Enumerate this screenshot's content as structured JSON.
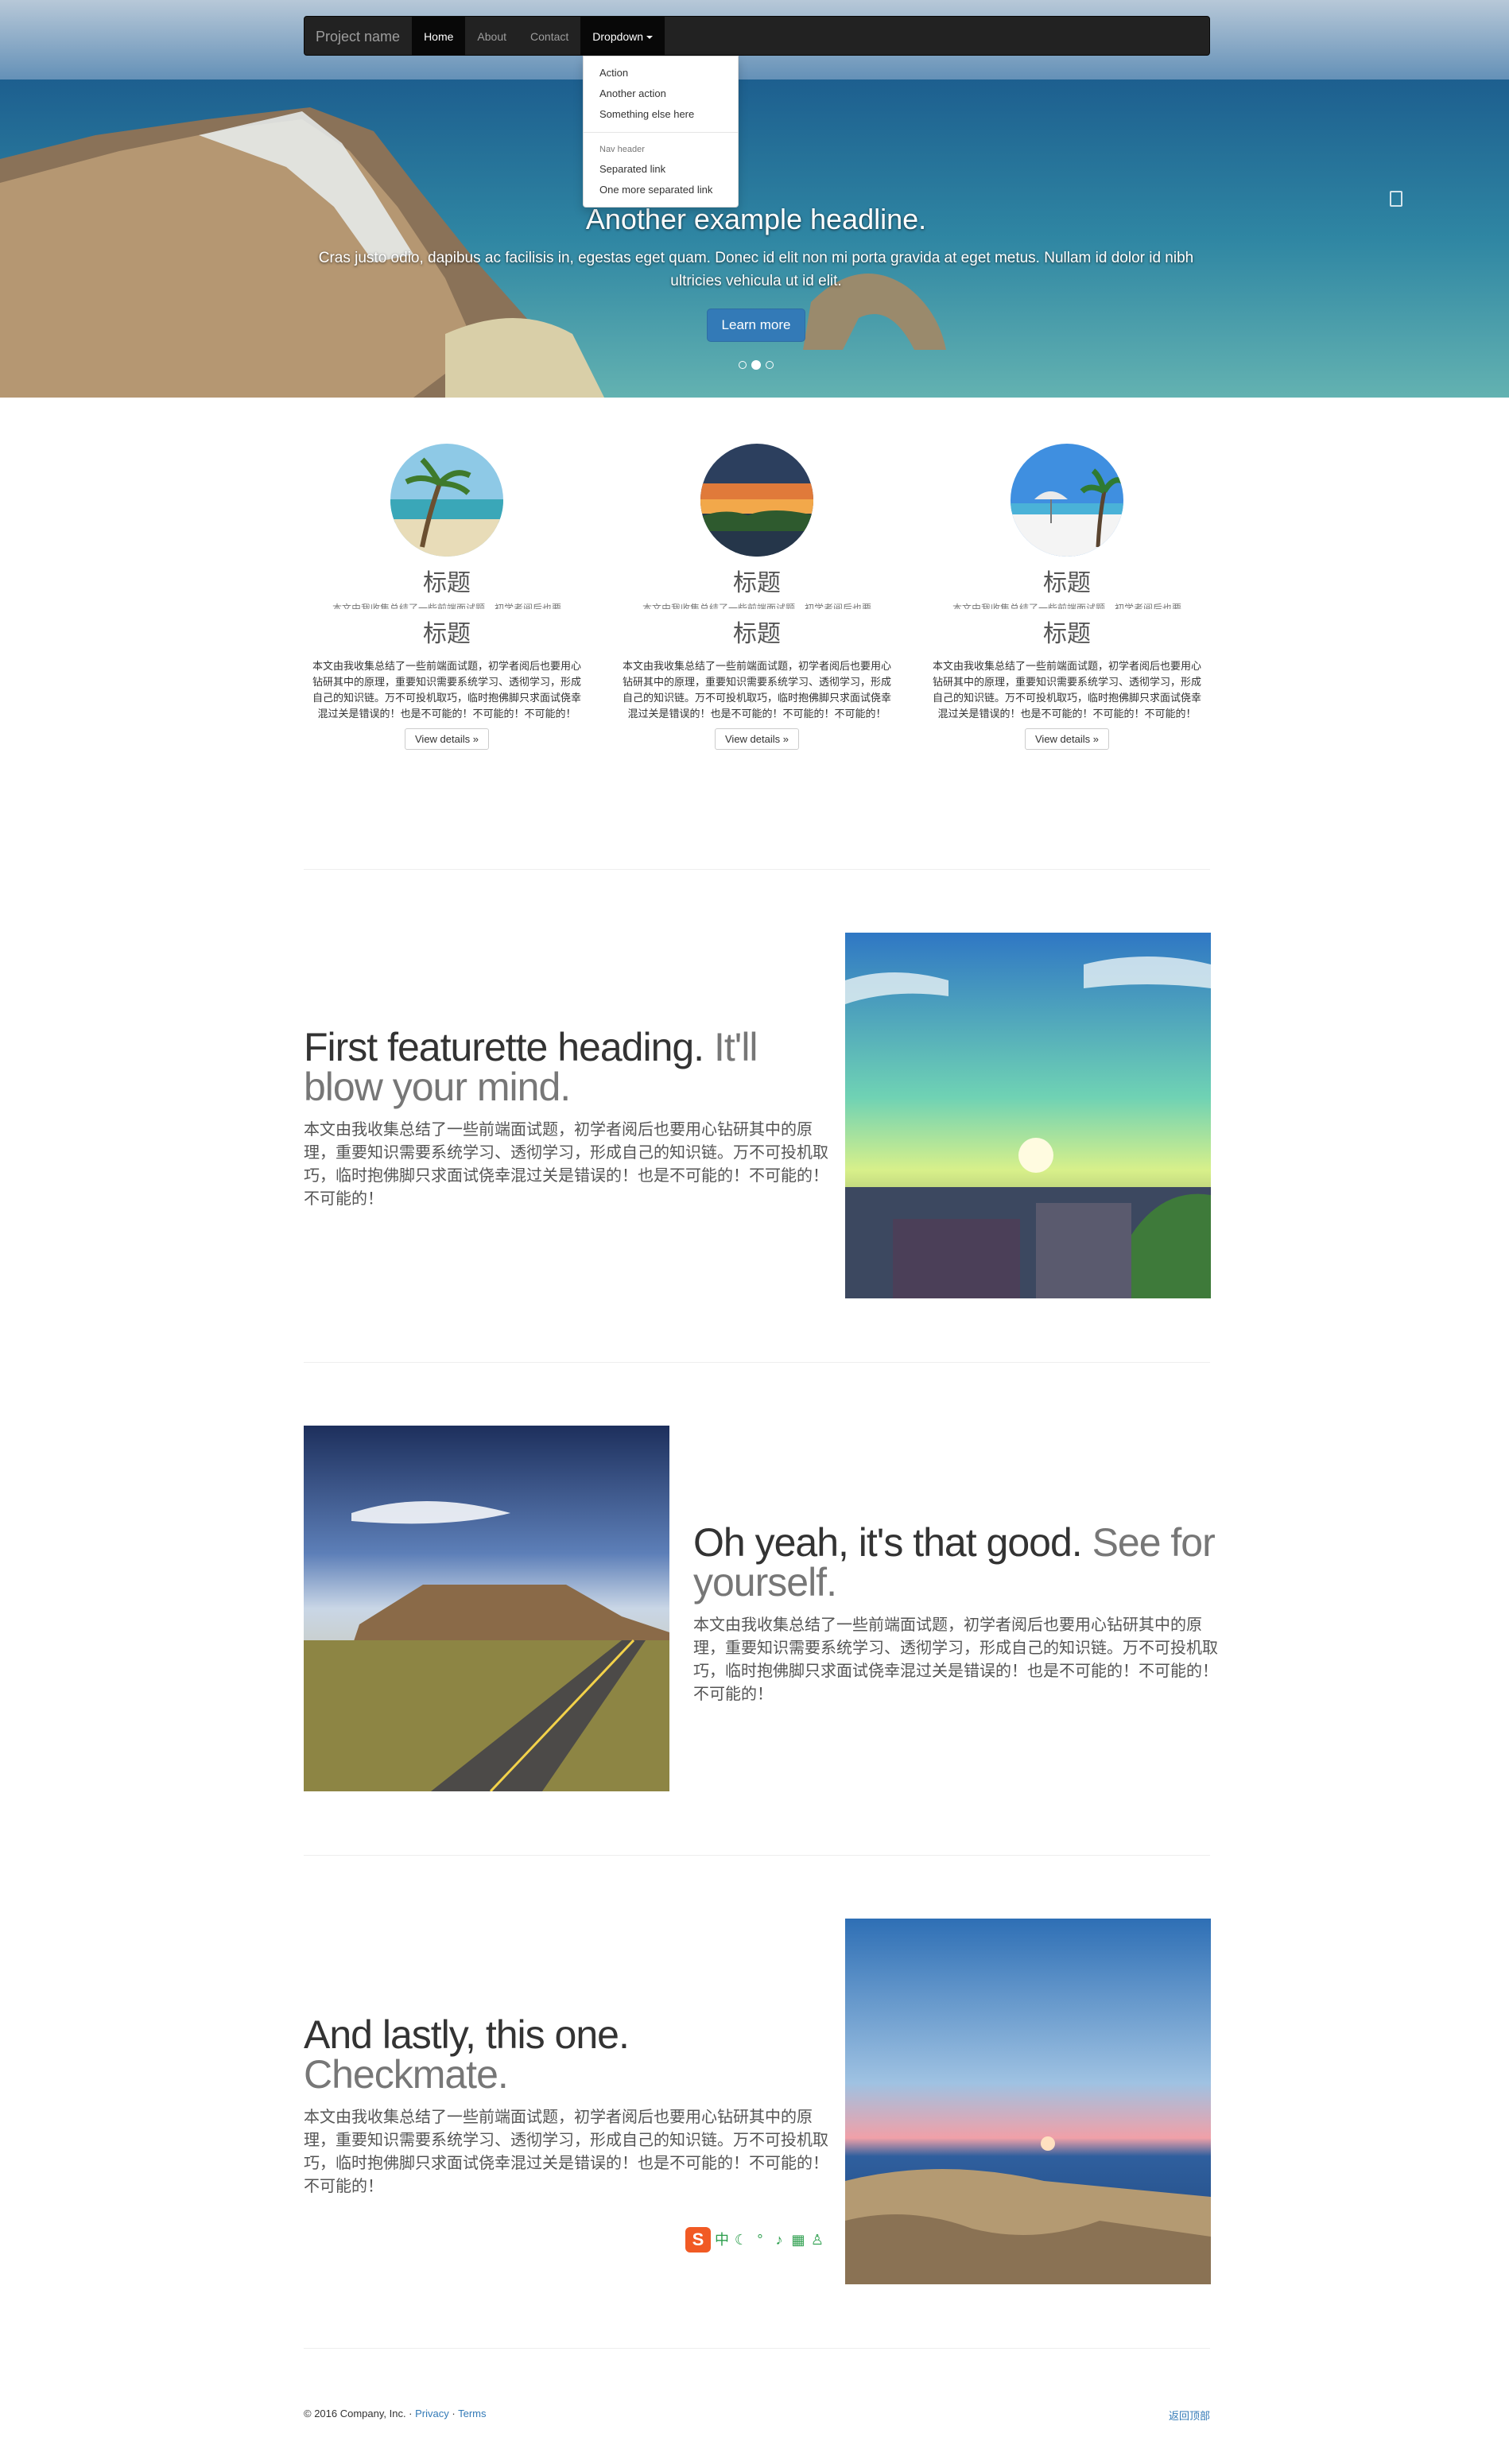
{
  "navbar": {
    "brand": "Project name",
    "items": [
      {
        "label": "Home"
      },
      {
        "label": "About"
      },
      {
        "label": "Contact"
      },
      {
        "label": "Dropdown"
      }
    ],
    "dropdown": {
      "items": [
        "Action",
        "Another action",
        "Something else here"
      ],
      "header": "Nav header",
      "items2": [
        "Separated link",
        "One more separated link"
      ]
    }
  },
  "carousel": {
    "headline": "Another example headline.",
    "text": "Cras justo odio, dapibus ac facilisis in, egestas eget quam. Donec id elit non mi porta gravida at eget metus. Nullam id dolor id nibh ultricies vehicula ut id elit.",
    "button": "Learn more",
    "slide_count": 3,
    "active_slide": 2
  },
  "columns": [
    {
      "title": "标题",
      "overlap": "本文由我收集总结了一些前端面试题，初学者阅后也要",
      "title2": "标题",
      "text": "本文由我收集总结了一些前端面试题，初学者阅后也要用心钻研其中的原理，重要知识需要系统学习、透彻学习，形成自己的知识链。万不可投机取巧，临时抱佛脚只求面试侥幸混过关是错误的！也是不可能的！不可能的！不可能的！",
      "button": "View details »"
    },
    {
      "title": "标题",
      "overlap": "本文由我收集总结了一些前端面试题，初学者阅后也要",
      "title2": "标题",
      "text": "本文由我收集总结了一些前端面试题，初学者阅后也要用心钻研其中的原理，重要知识需要系统学习、透彻学习，形成自己的知识链。万不可投机取巧，临时抱佛脚只求面试侥幸混过关是错误的！也是不可能的！不可能的！不可能的！",
      "button": "View details »"
    },
    {
      "title": "标题",
      "overlap": "本文由我收集总结了一些前端面试题，初学者阅后也要",
      "title2": "标题",
      "text": "本文由我收集总结了一些前端面试题，初学者阅后也要用心钻研其中的原理，重要知识需要系统学习、透彻学习，形成自己的知识链。万不可投机取巧，临时抱佛脚只求面试侥幸混过关是错误的！也是不可能的！不可能的！不可能的！",
      "button": "View details »"
    }
  ],
  "featurettes": [
    {
      "heading": "First featurette heading.",
      "muted": "It'll blow your mind.",
      "text": "本文由我收集总结了一些前端面试题，初学者阅后也要用心钻研其中的原理，重要知识需要系统学习、透彻学习，形成自己的知识链。万不可投机取巧，临时抱佛脚只求面试侥幸混过关是错误的！也是不可能的！不可能的！不可能的！"
    },
    {
      "heading": "Oh yeah, it's that good.",
      "muted": "See for yourself.",
      "text": "本文由我收集总结了一些前端面试题，初学者阅后也要用心钻研其中的原理，重要知识需要系统学习、透彻学习，形成自己的知识链。万不可投机取巧，临时抱佛脚只求面试侥幸混过关是错误的！也是不可能的！不可能的！不可能的！"
    },
    {
      "heading": "And lastly, this one.",
      "muted": "Checkmate.",
      "text": "本文由我收集总结了一些前端面试题，初学者阅后也要用心钻研其中的原理，重要知识需要系统学习、透彻学习，形成自己的知识链。万不可投机取巧，临时抱佛脚只求面试侥幸混过关是错误的！也是不可能的！不可能的！不可能的！"
    }
  ],
  "ime": {
    "logo": "S",
    "mode": "中"
  },
  "footer": {
    "copyright": "© 2016 Company, Inc. ·",
    "privacy": "Privacy",
    "sep": "·",
    "terms": "Terms",
    "back_to_top": "返回顶部"
  }
}
